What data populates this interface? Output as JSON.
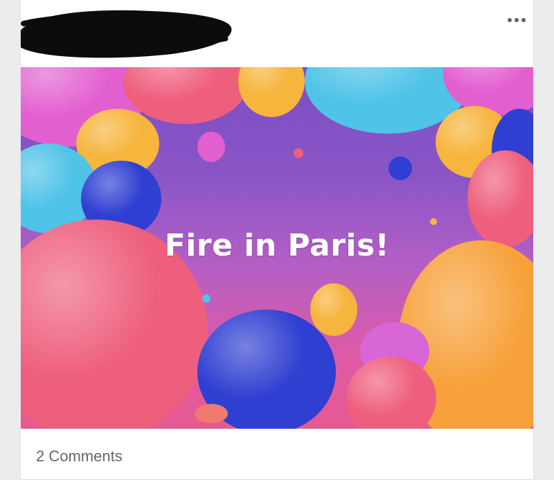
{
  "post": {
    "author_name_redacted": true,
    "more_icon": "more-horizontal-icon",
    "image": {
      "caption": "Fire in Paris!",
      "background_colors": [
        "#7b4fc4",
        "#df5aa6"
      ],
      "balloon_colors": {
        "pink": "#e25fd0",
        "coral": "#ee5f7e",
        "yellow": "#f6b53d",
        "orange": "#f7a13a",
        "cyan": "#4fc3e8",
        "blue": "#2f3fd1"
      }
    },
    "footer": {
      "comments_label": "2 Comments"
    }
  }
}
